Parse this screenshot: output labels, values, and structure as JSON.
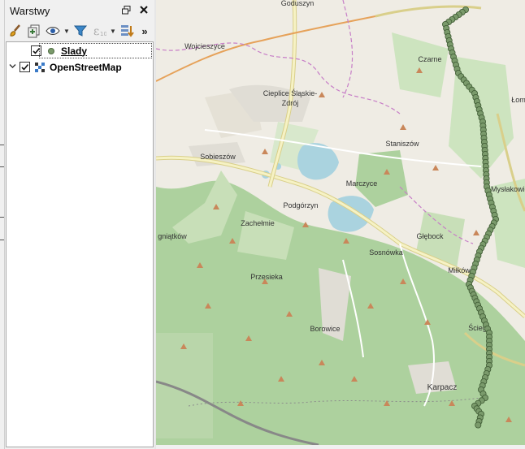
{
  "panel": {
    "title": "Warstwy",
    "float_icon": "float-icon",
    "close_icon": "close-icon",
    "more_label": "»"
  },
  "toolbar": {
    "icons": [
      "style-brush-icon",
      "add-group-icon",
      "visibility-eye-icon",
      "filter-icon",
      "expression-filter-icon",
      "expand-collapse-icon"
    ]
  },
  "layers": [
    {
      "name": "Slady",
      "checked": true,
      "symbol": "point-symbol-icon",
      "color": "#7a9a6b",
      "selected": true
    },
    {
      "name": "OpenStreetMap",
      "checked": true,
      "symbol": "raster-icon",
      "expanded": true
    }
  ],
  "map": {
    "colors": {
      "forest": "#add19e",
      "land": "#efece4",
      "water": "#aad3df",
      "road_major": "#f6f2c4",
      "road_outline": "#d9cf8a",
      "track": "#7a9a6b"
    },
    "places": [
      {
        "id": "goduszyn",
        "label": "Goduszyn"
      },
      {
        "id": "wojcieszyce",
        "label": "Wojcieszyce"
      },
      {
        "id": "czarne",
        "label": "Czarne"
      },
      {
        "id": "lom",
        "label": "Łom"
      },
      {
        "id": "cieplice",
        "label": "Cieplice Śląskie-"
      },
      {
        "id": "cieplice2",
        "label": "Zdrój"
      },
      {
        "id": "staniszow",
        "label": "Staniszów"
      },
      {
        "id": "sobieszow",
        "label": "Sobieszów"
      },
      {
        "id": "marczyce",
        "label": "Marczyce"
      },
      {
        "id": "myslakowice",
        "label": "Mysłakowic"
      },
      {
        "id": "podgorzyn",
        "label": "Podgórzyn"
      },
      {
        "id": "zachelmie",
        "label": "Zachełmie"
      },
      {
        "id": "gniatkow",
        "label": "gniątków"
      },
      {
        "id": "glebock",
        "label": "Głębock"
      },
      {
        "id": "sosnowka",
        "label": "Sosnówka"
      },
      {
        "id": "milkow",
        "label": "Miłków"
      },
      {
        "id": "przesieka",
        "label": "Przesieka"
      },
      {
        "id": "borowice",
        "label": "Borowice"
      },
      {
        "id": "sciegny",
        "label": "Ściegn"
      },
      {
        "id": "karpacz",
        "label": "Karpacz"
      }
    ]
  }
}
